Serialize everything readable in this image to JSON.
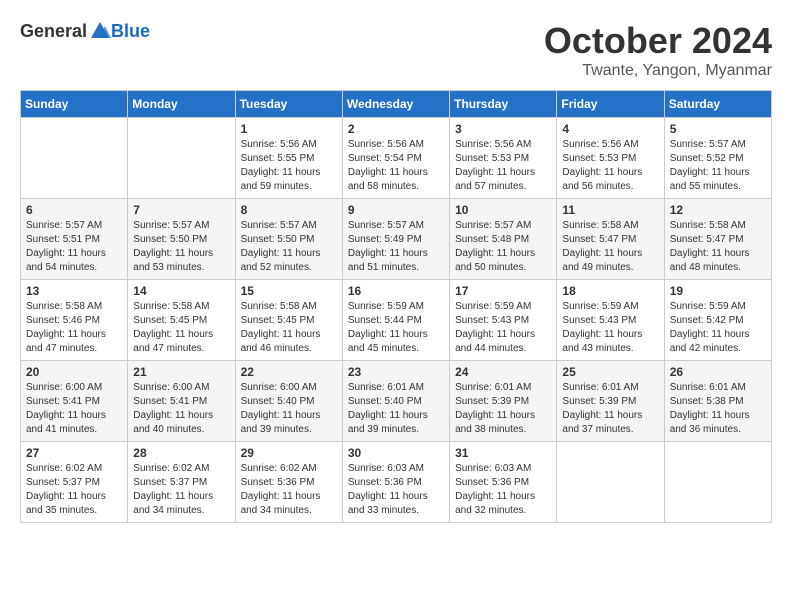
{
  "logo": {
    "text_general": "General",
    "text_blue": "Blue"
  },
  "header": {
    "month_title": "October 2024",
    "location": "Twante, Yangon, Myanmar"
  },
  "weekdays": [
    "Sunday",
    "Monday",
    "Tuesday",
    "Wednesday",
    "Thursday",
    "Friday",
    "Saturday"
  ],
  "weeks": [
    [
      {
        "day": "",
        "sunrise": "",
        "sunset": "",
        "daylight": ""
      },
      {
        "day": "",
        "sunrise": "",
        "sunset": "",
        "daylight": ""
      },
      {
        "day": "1",
        "sunrise": "Sunrise: 5:56 AM",
        "sunset": "Sunset: 5:55 PM",
        "daylight": "Daylight: 11 hours and 59 minutes."
      },
      {
        "day": "2",
        "sunrise": "Sunrise: 5:56 AM",
        "sunset": "Sunset: 5:54 PM",
        "daylight": "Daylight: 11 hours and 58 minutes."
      },
      {
        "day": "3",
        "sunrise": "Sunrise: 5:56 AM",
        "sunset": "Sunset: 5:53 PM",
        "daylight": "Daylight: 11 hours and 57 minutes."
      },
      {
        "day": "4",
        "sunrise": "Sunrise: 5:56 AM",
        "sunset": "Sunset: 5:53 PM",
        "daylight": "Daylight: 11 hours and 56 minutes."
      },
      {
        "day": "5",
        "sunrise": "Sunrise: 5:57 AM",
        "sunset": "Sunset: 5:52 PM",
        "daylight": "Daylight: 11 hours and 55 minutes."
      }
    ],
    [
      {
        "day": "6",
        "sunrise": "Sunrise: 5:57 AM",
        "sunset": "Sunset: 5:51 PM",
        "daylight": "Daylight: 11 hours and 54 minutes."
      },
      {
        "day": "7",
        "sunrise": "Sunrise: 5:57 AM",
        "sunset": "Sunset: 5:50 PM",
        "daylight": "Daylight: 11 hours and 53 minutes."
      },
      {
        "day": "8",
        "sunrise": "Sunrise: 5:57 AM",
        "sunset": "Sunset: 5:50 PM",
        "daylight": "Daylight: 11 hours and 52 minutes."
      },
      {
        "day": "9",
        "sunrise": "Sunrise: 5:57 AM",
        "sunset": "Sunset: 5:49 PM",
        "daylight": "Daylight: 11 hours and 51 minutes."
      },
      {
        "day": "10",
        "sunrise": "Sunrise: 5:57 AM",
        "sunset": "Sunset: 5:48 PM",
        "daylight": "Daylight: 11 hours and 50 minutes."
      },
      {
        "day": "11",
        "sunrise": "Sunrise: 5:58 AM",
        "sunset": "Sunset: 5:47 PM",
        "daylight": "Daylight: 11 hours and 49 minutes."
      },
      {
        "day": "12",
        "sunrise": "Sunrise: 5:58 AM",
        "sunset": "Sunset: 5:47 PM",
        "daylight": "Daylight: 11 hours and 48 minutes."
      }
    ],
    [
      {
        "day": "13",
        "sunrise": "Sunrise: 5:58 AM",
        "sunset": "Sunset: 5:46 PM",
        "daylight": "Daylight: 11 hours and 47 minutes."
      },
      {
        "day": "14",
        "sunrise": "Sunrise: 5:58 AM",
        "sunset": "Sunset: 5:45 PM",
        "daylight": "Daylight: 11 hours and 47 minutes."
      },
      {
        "day": "15",
        "sunrise": "Sunrise: 5:58 AM",
        "sunset": "Sunset: 5:45 PM",
        "daylight": "Daylight: 11 hours and 46 minutes."
      },
      {
        "day": "16",
        "sunrise": "Sunrise: 5:59 AM",
        "sunset": "Sunset: 5:44 PM",
        "daylight": "Daylight: 11 hours and 45 minutes."
      },
      {
        "day": "17",
        "sunrise": "Sunrise: 5:59 AM",
        "sunset": "Sunset: 5:43 PM",
        "daylight": "Daylight: 11 hours and 44 minutes."
      },
      {
        "day": "18",
        "sunrise": "Sunrise: 5:59 AM",
        "sunset": "Sunset: 5:43 PM",
        "daylight": "Daylight: 11 hours and 43 minutes."
      },
      {
        "day": "19",
        "sunrise": "Sunrise: 5:59 AM",
        "sunset": "Sunset: 5:42 PM",
        "daylight": "Daylight: 11 hours and 42 minutes."
      }
    ],
    [
      {
        "day": "20",
        "sunrise": "Sunrise: 6:00 AM",
        "sunset": "Sunset: 5:41 PM",
        "daylight": "Daylight: 11 hours and 41 minutes."
      },
      {
        "day": "21",
        "sunrise": "Sunrise: 6:00 AM",
        "sunset": "Sunset: 5:41 PM",
        "daylight": "Daylight: 11 hours and 40 minutes."
      },
      {
        "day": "22",
        "sunrise": "Sunrise: 6:00 AM",
        "sunset": "Sunset: 5:40 PM",
        "daylight": "Daylight: 11 hours and 39 minutes."
      },
      {
        "day": "23",
        "sunrise": "Sunrise: 6:01 AM",
        "sunset": "Sunset: 5:40 PM",
        "daylight": "Daylight: 11 hours and 39 minutes."
      },
      {
        "day": "24",
        "sunrise": "Sunrise: 6:01 AM",
        "sunset": "Sunset: 5:39 PM",
        "daylight": "Daylight: 11 hours and 38 minutes."
      },
      {
        "day": "25",
        "sunrise": "Sunrise: 6:01 AM",
        "sunset": "Sunset: 5:39 PM",
        "daylight": "Daylight: 11 hours and 37 minutes."
      },
      {
        "day": "26",
        "sunrise": "Sunrise: 6:01 AM",
        "sunset": "Sunset: 5:38 PM",
        "daylight": "Daylight: 11 hours and 36 minutes."
      }
    ],
    [
      {
        "day": "27",
        "sunrise": "Sunrise: 6:02 AM",
        "sunset": "Sunset: 5:37 PM",
        "daylight": "Daylight: 11 hours and 35 minutes."
      },
      {
        "day": "28",
        "sunrise": "Sunrise: 6:02 AM",
        "sunset": "Sunset: 5:37 PM",
        "daylight": "Daylight: 11 hours and 34 minutes."
      },
      {
        "day": "29",
        "sunrise": "Sunrise: 6:02 AM",
        "sunset": "Sunset: 5:36 PM",
        "daylight": "Daylight: 11 hours and 34 minutes."
      },
      {
        "day": "30",
        "sunrise": "Sunrise: 6:03 AM",
        "sunset": "Sunset: 5:36 PM",
        "daylight": "Daylight: 11 hours and 33 minutes."
      },
      {
        "day": "31",
        "sunrise": "Sunrise: 6:03 AM",
        "sunset": "Sunset: 5:36 PM",
        "daylight": "Daylight: 11 hours and 32 minutes."
      },
      {
        "day": "",
        "sunrise": "",
        "sunset": "",
        "daylight": ""
      },
      {
        "day": "",
        "sunrise": "",
        "sunset": "",
        "daylight": ""
      }
    ]
  ]
}
